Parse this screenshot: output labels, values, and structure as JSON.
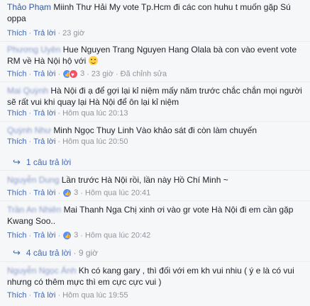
{
  "comments": [
    {
      "author": "Thảo Phạm",
      "text": "Miinh Thư Hải My vote Tp.Hcm đi các con huhu t muốn gặp Sú oppa",
      "like": "Thích",
      "reply": "Trả lời",
      "time": "23 giờ"
    },
    {
      "author": "Phương Uyên",
      "text": "Hue Nguyen Trang Nguyen Hang Olala bà con vào event vote RM về Hà Nội hộ với",
      "like": "Thích",
      "reply": "Trả lời",
      "reactions": "3",
      "time": "23 giờ",
      "edited": "Đã chỉnh sửa"
    },
    {
      "author": "Mai Quỳnh",
      "text": "Hà Nội đi ạ để gợi lại kỉ niệm mấy năm trước chắc chắn mọi người sẽ rất vui khi quay lại Hà Nội để ôn lại kỉ niệm",
      "like": "Thích",
      "reply": "Trả lời",
      "time": "Hôm qua lúc 20:13"
    },
    {
      "author": "Quỳnh Như",
      "text": "Minh Ngọc Thuy Linh Vào khảo sát đi còn làm chuyến",
      "like": "Thích",
      "reply": "Trả lời",
      "time": "Hôm qua lúc 20:50",
      "replies": "1 câu trả lời"
    },
    {
      "author": "Nguyễn Dung",
      "text": "Lần trước Hà Nội rồi, lần này Hồ Chí Minh ~",
      "like": "Thích",
      "reply": "Trả lời",
      "reactions": "3",
      "time": "Hôm qua lúc 20:41"
    },
    {
      "author": "Trần An Nhiên",
      "text": "Mai Thanh Nga Chị xinh ơi vào gr vote Hà Nội đi em cần gặp Kwang Soo..",
      "like": "Thích",
      "reply": "Trả lời",
      "reactions": "3",
      "time": "Hôm qua lúc 20:42",
      "replies": "4 câu trả lời",
      "replies_time": "9 giờ"
    },
    {
      "author": "Nguyễn Ngọc Ánh",
      "text": "Kh có kang gary , thì đối với em kh vui nhiu ( ý e là có vui nhưng có thêm mực thì em cực cực vui )",
      "like": "Thích",
      "reply": "Trả lời",
      "time": "Hôm qua lúc 19:55"
    }
  ],
  "colors": {
    "link": "#365899",
    "action": "#4267b2",
    "meta": "#90949c",
    "background": "#f6f7f9"
  }
}
